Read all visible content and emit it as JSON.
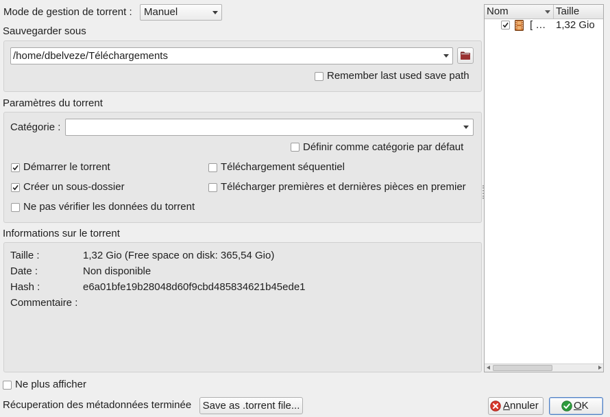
{
  "management_mode": {
    "label": "Mode de gestion de torrent :",
    "value": "Manuel"
  },
  "save_location": {
    "title": "Sauvegarder sous",
    "path": "/home/dbelveze/Téléchargements",
    "browse_icon": "folder-icon",
    "remember": {
      "label": "Remember last used save path",
      "checked": false
    }
  },
  "torrent_params": {
    "title": "Paramètres du torrent",
    "category": {
      "label": "Catégorie :",
      "value": ""
    },
    "default_category": {
      "label": "Définir comme catégorie par défaut",
      "checked": false
    },
    "start_torrent": {
      "label": "Démarrer le torrent",
      "checked": true
    },
    "sequential": {
      "label": "Téléchargement séquentiel",
      "checked": false
    },
    "create_subfolder": {
      "label": "Créer un sous-dossier",
      "checked": true
    },
    "first_last_pieces": {
      "label": "Télécharger premières et dernières pièces en premier",
      "checked": false
    },
    "skip_hash_check": {
      "label": "Ne pas vérifier les données du torrent",
      "checked": false
    }
  },
  "torrent_info": {
    "title": "Informations sur le torrent",
    "rows": [
      {
        "label": "Taille :",
        "value": "1,32 Gio (Free space on disk: 365,54 Gio)"
      },
      {
        "label": "Date :",
        "value": "Non disponible"
      },
      {
        "label": "Hash :",
        "value": "e6a01bfe19b28048d60f9cbd485834621b45ede1"
      },
      {
        "label": "Commentaire :",
        "value": ""
      }
    ]
  },
  "file_tree": {
    "columns": [
      "Nom",
      "Taille"
    ],
    "sort_icon": "sort-down-icon",
    "files": [
      {
        "name": "[ …",
        "size": "1,32 Gio",
        "checked": true,
        "icon": "film-icon"
      }
    ]
  },
  "footer": {
    "dont_show_again": {
      "label": "Ne plus afficher",
      "checked": false
    },
    "status": "Récuperation des métadonnées terminée",
    "save_torrent_button": "Save as .torrent file...",
    "cancel_button": {
      "label": "Annuler",
      "icon": "cancel-icon"
    },
    "ok_button": {
      "label": "OK",
      "icon": "ok-check-icon"
    }
  },
  "colors": {
    "window_bg": "#efefef",
    "group_bg": "#e7e7e7",
    "cancel_icon": "#d6382c",
    "ok_icon": "#2e9b3d",
    "folder_icon": "#9a3232",
    "film_icon": "#c8702c",
    "focus_border": "#4d7fc4"
  }
}
